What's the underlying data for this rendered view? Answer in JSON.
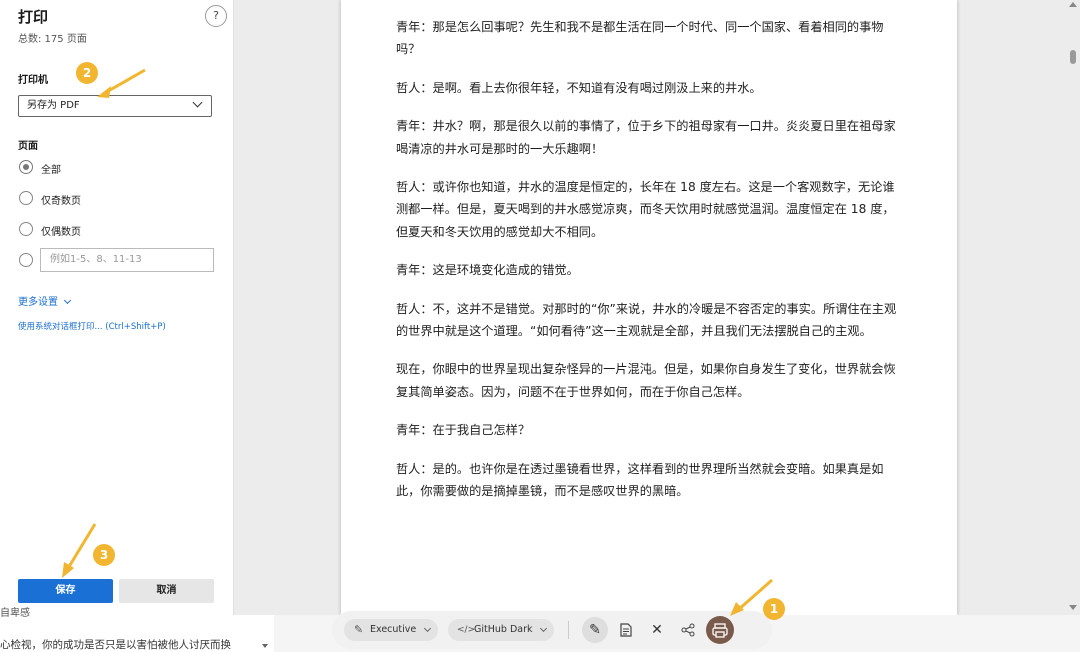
{
  "print_panel": {
    "title": "打印",
    "page_count": "总数: 175 页面",
    "help_label": "?",
    "printer_label": "打印机",
    "printer_value": "另存为 PDF",
    "pages_label": "页面",
    "options": [
      "全部",
      "仅奇数页",
      "仅偶数页"
    ],
    "range_placeholder": "例如1-5、8、11-13",
    "more_settings": "更多设置",
    "system_dialog": "使用系统对话框打印... (Ctrl+Shift+P)",
    "save_label": "保存",
    "cancel_label": "取消"
  },
  "preview": {
    "paragraphs": [
      "青年：那是怎么回事呢？先生和我不是都生活在同一个时代、同一个国家、看着相同的事物吗？",
      "哲人：是啊。看上去你很年轻，不知道有没有喝过刚汲上来的井水。",
      "青年：井水？啊，那是很久以前的事情了，位于乡下的祖母家有一口井。炎炎夏日里在祖母家喝清凉的井水可是那时的一大乐趣啊！",
      "哲人：或许你也知道，井水的温度是恒定的，长年在 18 度左右。这是一个客观数字，无论谁测都一样。但是，夏天喝到的井水感觉凉爽，而冬天饮用时就感觉温润。温度恒定在 18 度，但夏天和冬天饮用的感觉却大不相同。",
      "青年：这是环境变化造成的错觉。",
      "哲人：不，这并不是错觉。对那时的“你”来说，井水的冷暖是不容否定的事实。所谓住在主观的世界中就是这个道理。“如何看待”这一主观就是全部，并且我们无法摆脱自己的主观。",
      "现在，你眼中的世界呈现出复杂怪异的一片混沌。但是，如果你自身发生了变化，世界就会恢复其简单姿态。因为，问题不在于世界如何，而在于你自己怎样。",
      "青年：在于我自己怎样？",
      "哲人：是的。也许你是在透过墨镜看世界，这样看到的世界理所当然就会变暗。如果真是如此，你需要做的是摘掉墨镜，而不是感叹世界的黑暗。"
    ]
  },
  "bottom": {
    "left_text": "心检视，你的成功是否只是以害怕被他人讨厌而换",
    "left_text_top": "自卑感",
    "pill1": "Executive",
    "pill2": "GitHub Dark"
  },
  "annotations": [
    "1",
    "2",
    "3"
  ],
  "colors": {
    "accent": "#1b70d6",
    "badge": "#f1b52f",
    "print_button": "#7a5a4a"
  },
  "icons": [
    "help-icon",
    "chevron-down-icon",
    "pen-icon",
    "code-icon",
    "pencil-icon",
    "document-icon",
    "close-icon",
    "share-icon",
    "printer-icon"
  ]
}
